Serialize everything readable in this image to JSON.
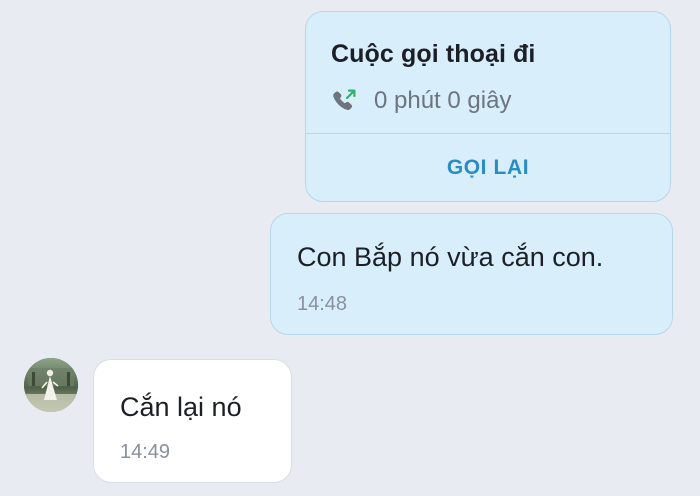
{
  "call_card": {
    "title": "Cuộc gọi thoại đi",
    "duration": "0 phút 0 giây",
    "callback_label": "GỌI LẠI",
    "icon": "outgoing-call-icon"
  },
  "outgoing_message": {
    "text": "Con Bắp nó vừa cắn con.",
    "time": "14:48"
  },
  "incoming_message": {
    "text": "Cắn lại nó",
    "time": "14:49",
    "avatar": "contact-avatar"
  },
  "colors": {
    "background": "#e8ebf2",
    "outgoing_bubble": "#d8eefb",
    "incoming_bubble": "#ffffff",
    "accent": "#2b8cc4",
    "call_arrow": "#2fb36b"
  }
}
